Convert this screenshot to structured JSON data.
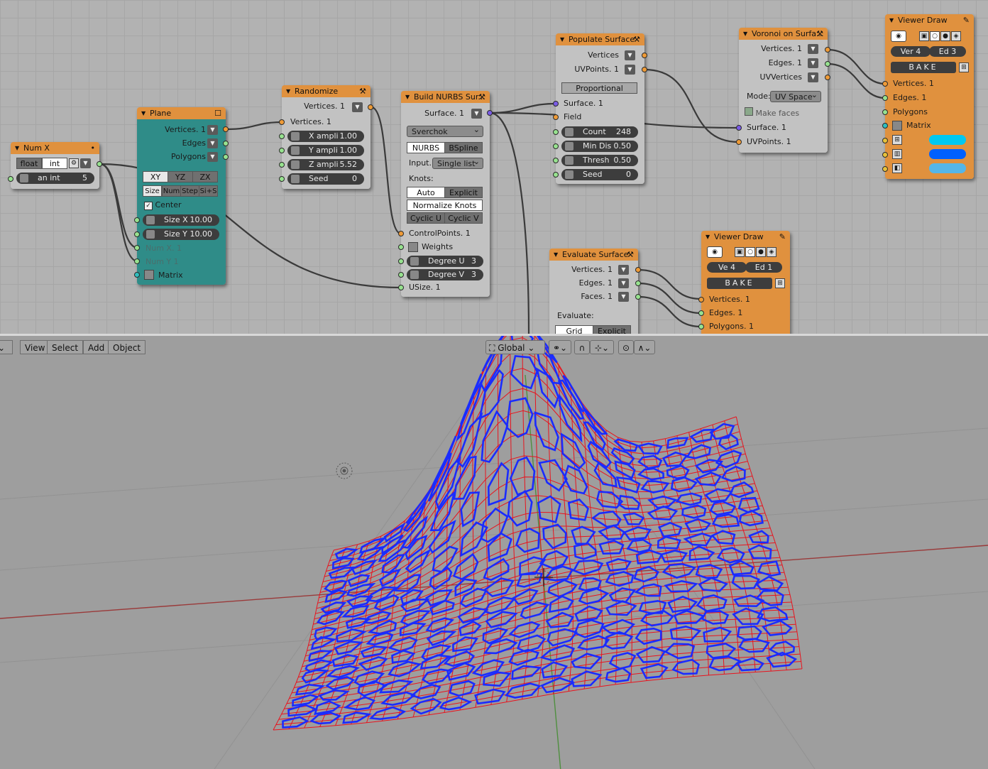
{
  "nodes": {
    "numx": {
      "title": "Num X",
      "type_float": "float",
      "type_int": "int",
      "field_label": "an int",
      "field_value": "5"
    },
    "plane": {
      "title": "Plane",
      "out_vertices": "Vertices. 1",
      "out_edges": "Edges",
      "out_polygons": "Polygons",
      "dir_xy": "XY",
      "dir_yz": "YZ",
      "dir_zx": "ZX",
      "mode_size": "Size",
      "mode_num": "Num",
      "mode_step": "Step",
      "mode_sis": "Si+S",
      "center": "Center",
      "size_x_label": "Size X",
      "size_x_value": "10.00",
      "size_y_label": "Size Y",
      "size_y_value": "10.00",
      "in_numx": "Num X. 1",
      "in_numy": "Num Y 1",
      "in_matrix": "Matrix"
    },
    "randomize": {
      "title": "Randomize",
      "out_vertices": "Vertices. 1",
      "in_vertices": "Vertices. 1",
      "xa_label": "X ampli",
      "xa_value": "1.00",
      "ya_label": "Y ampli",
      "ya_value": "1.00",
      "za_label": "Z ampli",
      "za_value": "5.52",
      "seed_label": "Seed",
      "seed_value": "0"
    },
    "nurbs": {
      "title": "Build NURBS Sur...",
      "out_surface": "Surface. 1",
      "impl": "Sverchok",
      "nurbs": "NURBS",
      "bspline": "BSpline",
      "input_label": "Input...",
      "input_value": "Single list",
      "knots_label": "Knots:",
      "auto": "Auto",
      "explicit": "Explicit",
      "normalize": "Normalize Knots",
      "cyclic_u": "Cyclic U",
      "cyclic_v": "Cyclic V",
      "in_control": "ControlPoints. 1",
      "in_weights": "Weights",
      "deg_u_label": "Degree U",
      "deg_u_value": "3",
      "deg_v_label": "Degree V",
      "deg_v_value": "3",
      "in_usize": "USize. 1"
    },
    "populate": {
      "title": "Populate Surface",
      "out_vertices": "Vertices",
      "out_uvpoints": "UVPoints. 1",
      "proportional": "Proportional",
      "in_surface": "Surface. 1",
      "in_field": "Field",
      "count_label": "Count",
      "count_value": "248",
      "mindis_label": "Min Dis",
      "mindis_value": "0.50",
      "thresh_label": "Thresh",
      "thresh_value": "0.50",
      "seed_label": "Seed",
      "seed_value": "0"
    },
    "voronoi": {
      "title": "Voronoi on Surfa...",
      "out_vertices": "Vertices. 1",
      "out_edges": "Edges. 1",
      "out_uvvertices": "UVVertices",
      "mode_label": "Mode:",
      "mode_value": "UV Space",
      "make_faces": "Make faces",
      "in_surface": "Surface. 1",
      "in_uvpoints": "UVPoints. 1"
    },
    "viewer1": {
      "title": "Viewer Draw",
      "ver": "Ver 4",
      "ed": "Ed  3",
      "bake": "BAKE",
      "in_vertices": "Vertices. 1",
      "in_edges": "Edges. 1",
      "in_polygons": "Polygons",
      "in_matrix": "Matrix",
      "colors": [
        "#00c8f0",
        "#0060ff",
        "#55b6e8"
      ]
    },
    "evaluate": {
      "title": "Evaluate Surface",
      "out_vertices": "Vertices. 1",
      "out_edges": "Edges. 1",
      "out_faces": "Faces. 1",
      "evaluate_label": "Evaluate:",
      "grid": "Grid",
      "explicit": "Explicit"
    },
    "viewer2": {
      "title": "Viewer Draw",
      "ver": "Ve  4",
      "ed": "Ed  1",
      "bake": "BAKE",
      "in_vertices": "Vertices. 1",
      "in_edges": "Edges. 1",
      "in_polygons": "Polygons. 1"
    }
  },
  "viewport_header": {
    "view": "View",
    "select": "Select",
    "add": "Add",
    "object": "Object",
    "orientation": "Global"
  },
  "colors": {
    "node_header": "#e0913e",
    "grid_bg": "#b2b2b2",
    "teal": "#2f8c88",
    "mesh_red": "#e8141e",
    "voronoi_blue": "#1a2cff"
  }
}
